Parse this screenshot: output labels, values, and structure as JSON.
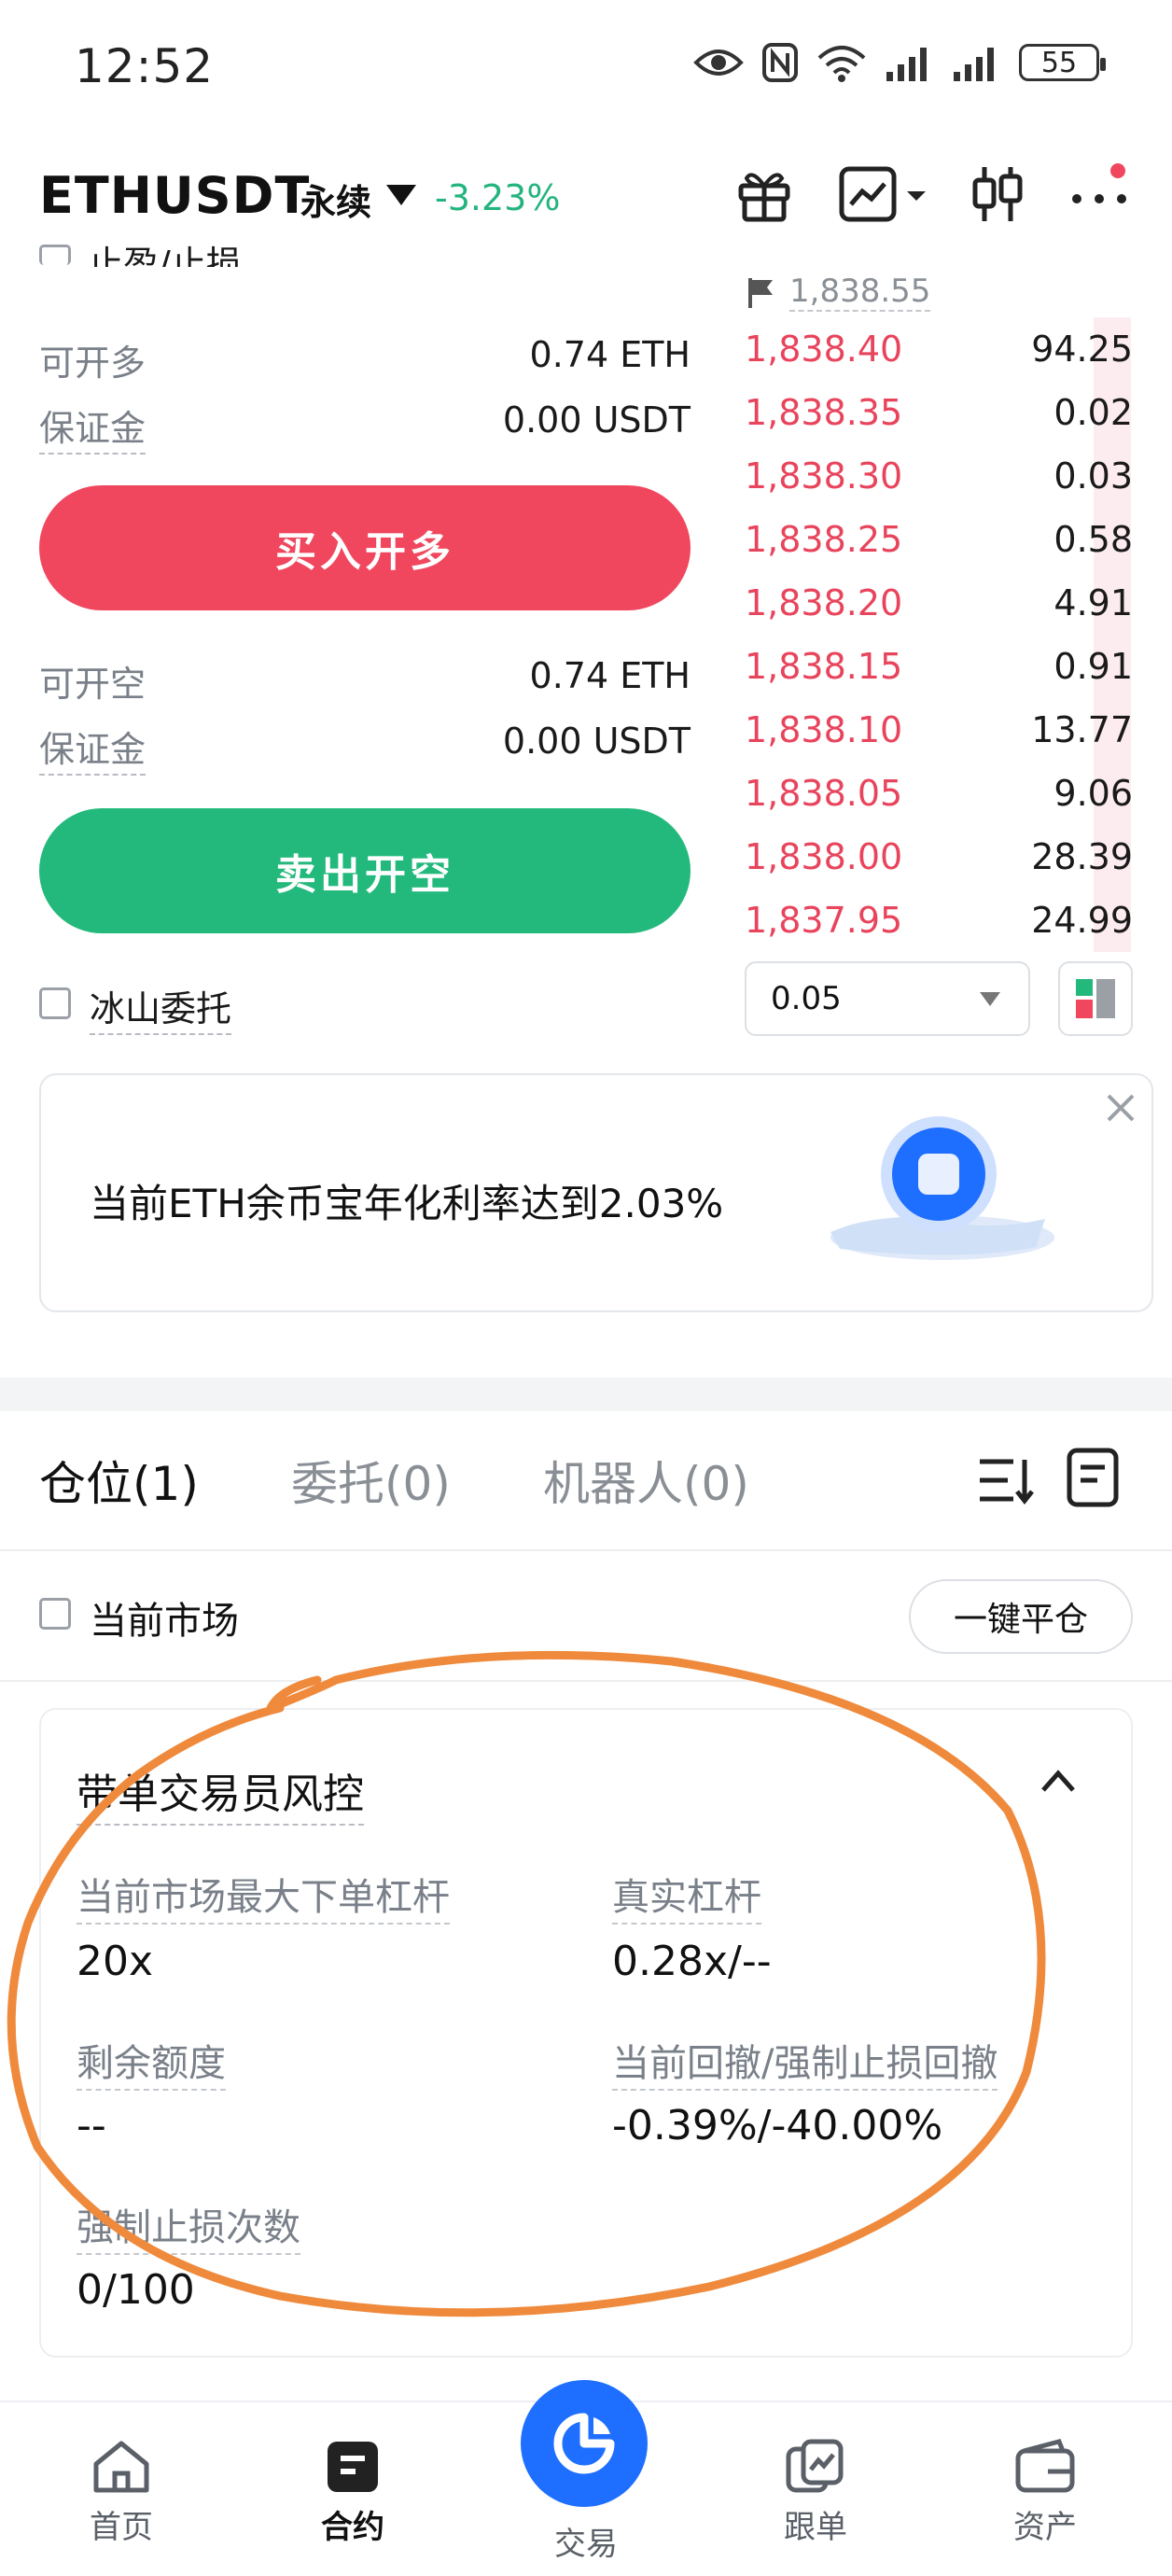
{
  "status_bar": {
    "time": "12:52",
    "battery": "55"
  },
  "header": {
    "symbol": "ETHUSDT",
    "contract_type": "永续",
    "change": "-3.23%"
  },
  "left_panel": {
    "top_partial_label": "止盈/止损",
    "long": {
      "avail_label": "可开多",
      "avail_value": "0.74 ETH",
      "margin_label": "保证金",
      "margin_value": "0.00 USDT",
      "button": "买入开多"
    },
    "short": {
      "avail_label": "可开空",
      "avail_value": "0.74 ETH",
      "margin_label": "保证金",
      "margin_value": "0.00 USDT",
      "button": "卖出开空"
    },
    "iceberg_label": "冰山委托"
  },
  "order_book": {
    "mark_price": "1,838.55",
    "asks": [
      {
        "price": "1,838.40",
        "qty": "94.25"
      },
      {
        "price": "1,838.35",
        "qty": "0.02"
      },
      {
        "price": "1,838.30",
        "qty": "0.03"
      },
      {
        "price": "1,838.25",
        "qty": "0.58"
      },
      {
        "price": "1,838.20",
        "qty": "4.91"
      },
      {
        "price": "1,838.15",
        "qty": "0.91"
      },
      {
        "price": "1,838.10",
        "qty": "13.77"
      },
      {
        "price": "1,838.05",
        "qty": "9.06"
      },
      {
        "price": "1,838.00",
        "qty": "28.39"
      },
      {
        "price": "1,837.95",
        "qty": "24.99"
      }
    ],
    "precision": "0.05"
  },
  "promo": {
    "text": "当前ETH余币宝年化利率达到2.03%"
  },
  "positions": {
    "tabs": [
      {
        "label": "仓位(1)"
      },
      {
        "label": "委托(0)"
      },
      {
        "label": "机器人(0)"
      }
    ],
    "current_market_label": "当前市场",
    "close_all_button": "一键平仓"
  },
  "risk": {
    "title": "带单交易员风控",
    "max_leverage_label": "当前市场最大下单杠杆",
    "max_leverage_value": "20x",
    "real_leverage_label": "真实杠杆",
    "real_leverage_value": "0.28x/--",
    "remaining_label": "剩余额度",
    "remaining_value": "--",
    "drawdown_label": "当前回撤/强制止损回撤",
    "drawdown_value": "-0.39%/-40.00%",
    "stoploss_count_label": "强制止损次数",
    "stoploss_count_value": "0/100"
  },
  "bottom_nav": [
    {
      "label": "首页"
    },
    {
      "label": "合约"
    },
    {
      "label": "交易"
    },
    {
      "label": "跟单"
    },
    {
      "label": "资产"
    }
  ],
  "colors": {
    "up": "#24b97c",
    "down": "#f0475e",
    "brand": "#1e6fff",
    "annotation": "#ef8a3c"
  }
}
